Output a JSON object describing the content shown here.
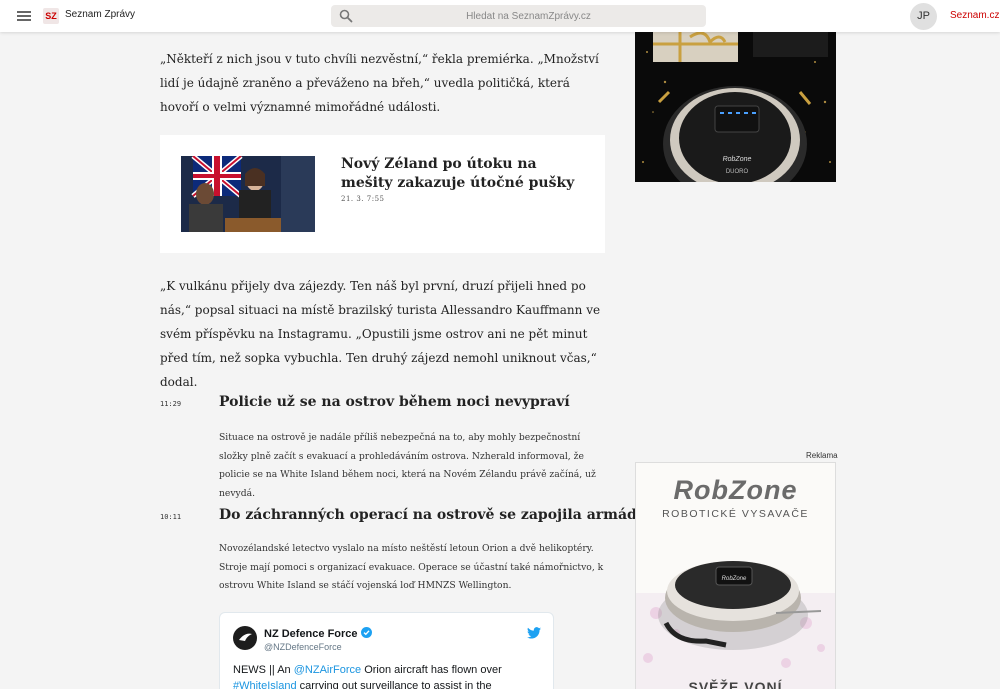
{
  "header": {
    "logo_badge": "SZ",
    "site_name": "Seznam Zprávy",
    "search_placeholder": "Hledat na SeznamZprávy.cz",
    "avatar_initials": "JP",
    "seznam_link": "Seznam.cz"
  },
  "article": {
    "para1": "„Někteří z nich jsou v tuto chvíli nezvěstní,“ řekla premiérka. „Množství lidí je údajně zraněno a převáženo na břeh,“ uvedla političká, která hovoří o velmi významné mimořádné události.",
    "related": {
      "title": "Nový Zéland po útoku na mešity zakazuje útočné pušky",
      "date": "21. 3. 7:55"
    },
    "para2": "„K vulkánu přijely dva zájezdy. Ten náš byl první, druzí přijeli hned po nás,“ popsal situaci na místě brazilský turista Allessandro Kauffmann ve svém příspěvku na Instagramu. „Opustili jsme ostrov ani ne pět minut před tím, než sopka vybuchla. Ten druhý zájezd nemohl uniknout včas,“ dodal."
  },
  "live": [
    {
      "time": "11:29",
      "heading": "Policie už se na ostrov během noci nevypraví",
      "text": "Situace na ostrově je nadále příliš nebezpečná na to, aby mohly bezpečnostní složky plně začít s evakuací a prohledáváním ostrova. Nzherald informoval, že policie se na White Island během noci, která na Novém Zélandu právě začíná, už nevydá."
    },
    {
      "time": "10:11",
      "heading": "Do záchranných operací na ostrově se zapojila armáda",
      "text": "Novozélandské letectvo vyslalo na místo neštěstí letoun Orion a dvě helikoptéry. Stroje mají pomoci s organizací evakuace. Operace se účastní také námořnictvo, k ostrovu White Island se stáčí vojenská loď HMNZS Wellington."
    }
  ],
  "tweet": {
    "name": "NZ Defence Force",
    "handle": "@NZDefenceForce",
    "text_prefix": "NEWS || An ",
    "mention": "@NZAirForce",
    "text_mid": " Orion aircraft has flown over ",
    "hashtag": "#WhiteIsland",
    "text_suffix": " carrying out surveillance to assist in the"
  },
  "ads": {
    "reklama_label": "Reklama",
    "top_device_brand": "RobZone",
    "top_device_model": "DUORO",
    "brand": "RobZone",
    "subtitle": "ROBOTICKÉ VYSAVAČE",
    "device_brand": "RobZone",
    "slogan": "SVĚŽE VONÍ"
  }
}
